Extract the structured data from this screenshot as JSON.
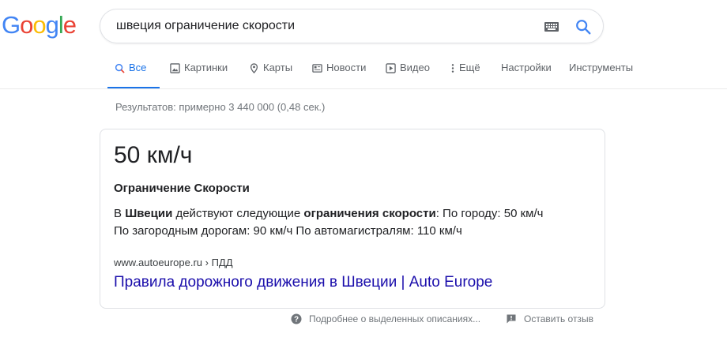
{
  "logo": {
    "letters": [
      "G",
      "o",
      "o",
      "g",
      "l",
      "e"
    ],
    "colors": [
      "#4285f4",
      "#ea4335",
      "#fbbc05",
      "#4285f4",
      "#34a853",
      "#ea4335"
    ]
  },
  "search": {
    "query": "швеция ограничение скорости"
  },
  "tabs": [
    {
      "label": "Все",
      "icon": "search-icon",
      "active": true
    },
    {
      "label": "Картинки",
      "icon": "image-icon"
    },
    {
      "label": "Карты",
      "icon": "map-pin-icon"
    },
    {
      "label": "Новости",
      "icon": "news-icon"
    },
    {
      "label": "Видео",
      "icon": "video-icon"
    },
    {
      "label": "Ещё",
      "icon": "more-vert-icon"
    },
    {
      "label": "Настройки"
    },
    {
      "label": "Инструменты"
    }
  ],
  "results_count": "Результатов: примерно 3 440 000 (0,48 сек.)",
  "featured": {
    "answer": "50 км/ч",
    "subtitle": "Ограничение Скорости",
    "snippet": {
      "p1": "В ",
      "b1": "Швеции",
      "p2": " действуют следующие ",
      "b2": "ограничения скорости",
      "p3": ": По городу: 50 км/ч",
      "line2": "По загородным дорогам: 90 км/ч По автомагистралям: 110 км/ч"
    },
    "cite": "www.autoeurope.ru › ПДД",
    "link_title": "Правила дорожного движения в Швеции | Auto Europe"
  },
  "footer": {
    "about": "Подробнее о выделенных описаниях...",
    "feedback": "Оставить отзыв"
  },
  "colors": {
    "accent": "#1a73e8",
    "link": "#1a0dab"
  }
}
